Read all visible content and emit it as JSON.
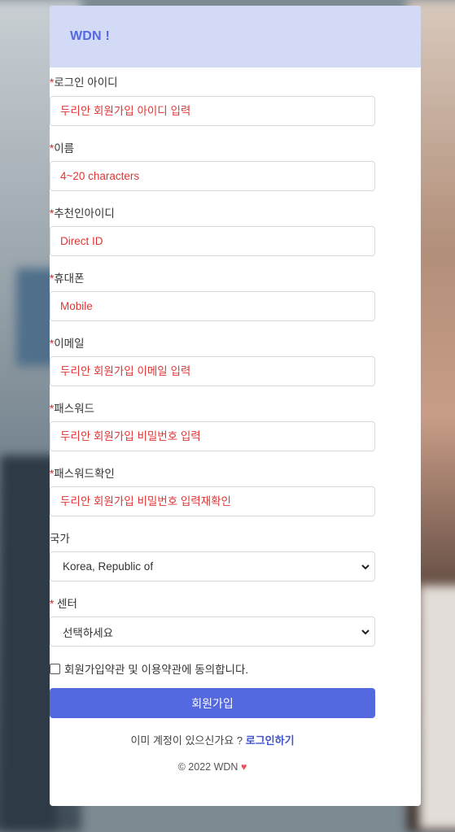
{
  "brand": "WDN !",
  "fields": [
    {
      "label": "로그인 아이디",
      "required": true,
      "placeholder": "두리안 회원가입 아이디 입력"
    },
    {
      "label": "이름",
      "required": true,
      "placeholder": "4~20 characters"
    },
    {
      "label": "추천인아이디",
      "required": true,
      "placeholder": "Direct ID"
    },
    {
      "label": "휴대폰",
      "required": true,
      "placeholder": "Mobile"
    },
    {
      "label": "이메일",
      "required": true,
      "placeholder": "두리안 회원가입 이메일 입력"
    },
    {
      "label": "패스워드",
      "required": true,
      "placeholder": "두리안 회원가입 비밀번호 입력"
    },
    {
      "label": "패스워드확인",
      "required": true,
      "placeholder": "두리안 회원가입 비밀번호 입력재확인"
    }
  ],
  "country": {
    "label": "국가",
    "value": "Korea, Republic of"
  },
  "center": {
    "required_mark": "*",
    "label": "센터",
    "value": "선택하세요"
  },
  "required_mark": "*",
  "agree_label": "회원가입약관 및 이용약관에 동의합니다.",
  "signup_button": "회원가입",
  "login_prompt": "이미 계정이 있으신가요 ?",
  "login_link": "로그인하기",
  "footer": "© 2022 WDN",
  "colors": {
    "accent": "#5468e0",
    "header_bg": "#d2daf6",
    "placeholder": "#e03535",
    "heart": "#ef4d5c"
  }
}
